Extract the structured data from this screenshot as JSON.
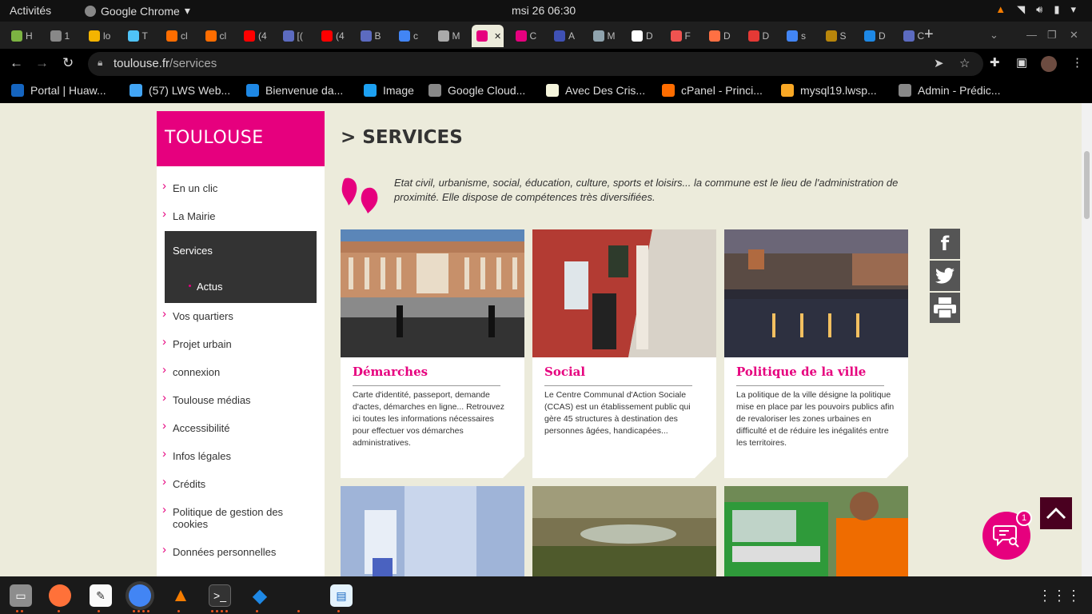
{
  "system": {
    "activities": "Activités",
    "app_name": "Google Chrome",
    "clock": "msi 26  06:30"
  },
  "tabs": [
    {
      "label": "H",
      "color": "#7cb342"
    },
    {
      "label": "1",
      "color": "#888"
    },
    {
      "label": "lo",
      "color": "#f4b400"
    },
    {
      "label": "T",
      "color": "#4fc3f7"
    },
    {
      "label": "cl",
      "color": "#ff6d00"
    },
    {
      "label": "cl",
      "color": "#ff6d00"
    },
    {
      "label": "(4",
      "color": "#ff0000"
    },
    {
      "label": "[(",
      "color": "#5c6bc0"
    },
    {
      "label": "(4",
      "color": "#ff0000"
    },
    {
      "label": "B",
      "color": "#5c6bc0"
    },
    {
      "label": "c",
      "color": "#4285f4"
    },
    {
      "label": "M",
      "color": "#aaa"
    },
    {
      "label": "",
      "color": "#e6007e"
    },
    {
      "label": "C",
      "color": "#e6007e"
    },
    {
      "label": "A",
      "color": "#3f51b5"
    },
    {
      "label": "M",
      "color": "#90a4ae"
    },
    {
      "label": "D",
      "color": "#fff"
    },
    {
      "label": "F",
      "color": "#ef5350"
    },
    {
      "label": "D",
      "color": "#ff7043"
    },
    {
      "label": "D",
      "color": "#e53935"
    },
    {
      "label": "s",
      "color": "#4285f4"
    },
    {
      "label": "S",
      "color": "#b8860b"
    },
    {
      "label": "D",
      "color": "#1e88e5"
    },
    {
      "label": "C",
      "color": "#5c6bc0"
    }
  ],
  "address": {
    "domain": "toulouse.fr",
    "path": "/services"
  },
  "bookmarks": [
    {
      "label": "Portal | Huaw...",
      "color": "#1565c0"
    },
    {
      "label": "(57) LWS Web...",
      "color": "#42a5f5"
    },
    {
      "label": "Bienvenue da...",
      "color": "#1e88e5"
    },
    {
      "label": "Image",
      "color": "#1da1f2"
    },
    {
      "label": "Google Cloud...",
      "color": "#888"
    },
    {
      "label": "Avec Des Cris...",
      "color": "#f5f5dc"
    },
    {
      "label": "cPanel - Princi...",
      "color": "#ff6d00"
    },
    {
      "label": "mysql19.lwsp...",
      "color": "#f9a825"
    },
    {
      "label": "Admin - Prédic...",
      "color": "#888"
    }
  ],
  "site": {
    "logo": "TOULOUSE",
    "menu": [
      "En un clic",
      "La Mairie",
      "Vos quartiers",
      "Projet urbain",
      "connexion",
      "Toulouse médias",
      "Accessibilité",
      "Infos légales",
      "Crédits",
      "Politique de gestion des cookies",
      "Données personnelles"
    ],
    "active_section": "Services",
    "active_sub": "Actus",
    "page_title": "> SERVICES",
    "intro": "Etat civil, urbanisme, social, éducation, culture, sports et loisirs... la commune est le lieu de l'administration de proximité. Elle dispose de compétences très diversifiées.",
    "cards": [
      {
        "title": "Démarches",
        "desc": "Carte d'identité, passeport, demande d'actes, démarches en ligne... Retrouvez ici toutes les informations nécessaires pour effectuer vos démarches administratives."
      },
      {
        "title": "Social",
        "desc": "Le Centre Communal d'Action Sociale (CCAS) est un établissement public qui gère 45 structures à destination des personnes âgées, handicapées..."
      },
      {
        "title": "Politique de la ville",
        "desc": "La politique de la ville désigne la politique mise en place par les pouvoirs publics afin de revaloriser les zones urbaines en difficulté et de réduire les inégalités entre les territoires."
      }
    ],
    "chat_badge": "1"
  }
}
